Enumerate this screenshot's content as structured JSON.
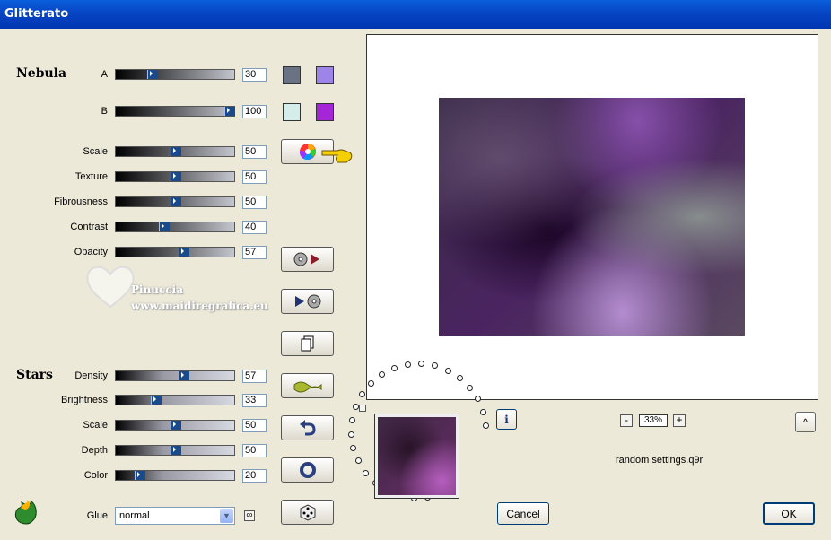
{
  "window": {
    "title": "Glitterato"
  },
  "nebula": {
    "section_label": "Nebula",
    "sliders": [
      {
        "label": "A",
        "value": "30",
        "level": 30
      },
      {
        "label": "B",
        "value": "100",
        "level": 100
      },
      {
        "label": "Scale",
        "value": "50",
        "level": 50
      },
      {
        "label": "Texture",
        "value": "50",
        "level": 50
      },
      {
        "label": "Fibrousness",
        "value": "50",
        "level": 50
      },
      {
        "label": "Contrast",
        "value": "40",
        "level": 40
      },
      {
        "label": "Opacity",
        "value": "57",
        "level": 57
      }
    ],
    "colors": {
      "a_left": "#6a7384",
      "a_right": "#9d84e8",
      "b_left": "#d4ecea",
      "b_right": "#a426d6"
    }
  },
  "stars": {
    "section_label": "Stars",
    "sliders": [
      {
        "label": "Density",
        "value": "57",
        "level": 57
      },
      {
        "label": "Brightness",
        "value": "33",
        "level": 33
      },
      {
        "label": "Scale",
        "value": "50",
        "level": 50
      },
      {
        "label": "Depth",
        "value": "50",
        "level": 50
      },
      {
        "label": "Color",
        "value": "20",
        "level": 20
      }
    ]
  },
  "glue": {
    "label": "Glue",
    "value": "normal"
  },
  "watermark": {
    "name": "Pinuccia",
    "site": "www.maidiregrafica.eu"
  },
  "zoom": {
    "value": "33%",
    "minus": "-",
    "plus": "+"
  },
  "settings_file": "random settings.q9r",
  "buttons": {
    "cancel": "Cancel",
    "ok": "OK",
    "info": "i",
    "up": "^"
  }
}
